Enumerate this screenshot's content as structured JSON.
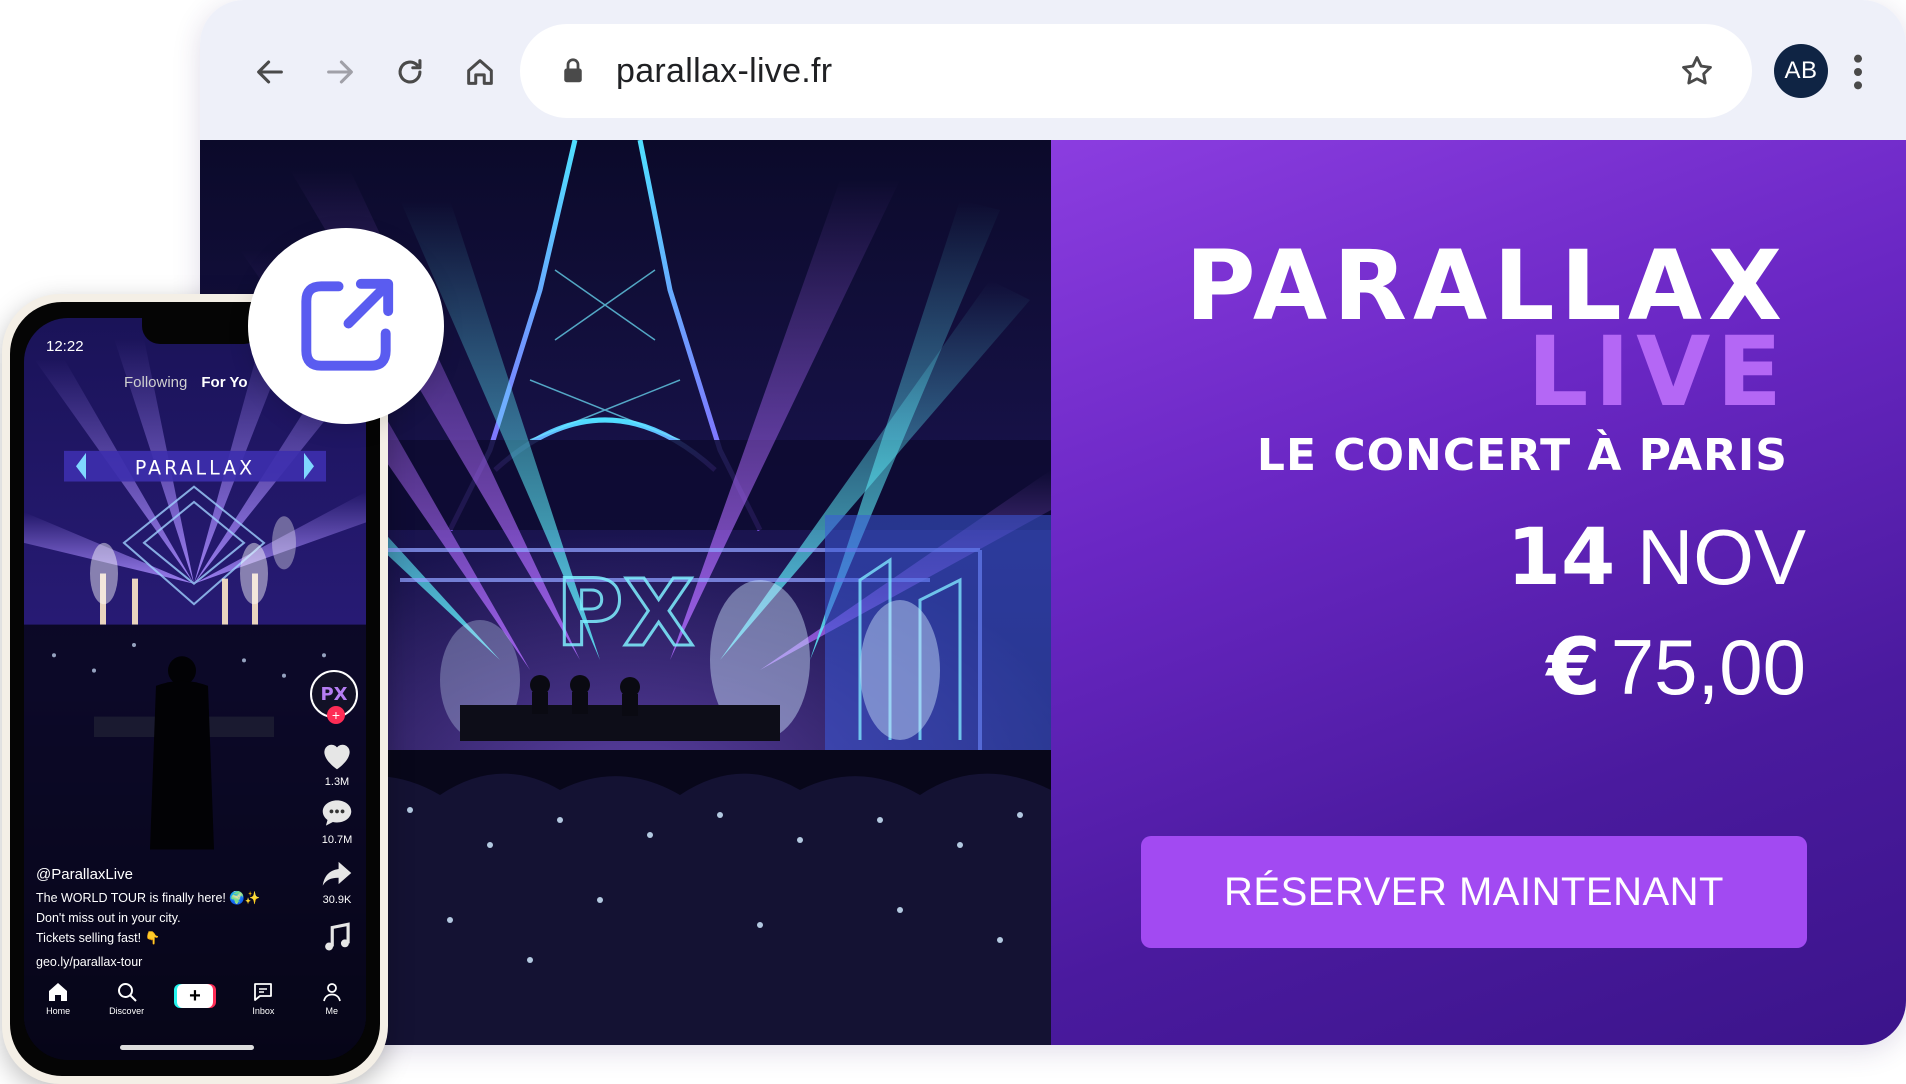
{
  "browser": {
    "url": "parallax-live.fr",
    "avatar_initials": "AB",
    "icons": {
      "back": "arrow-left-icon",
      "forward": "arrow-right-icon",
      "reload": "reload-icon",
      "home": "home-icon",
      "lock": "lock-icon",
      "bookmark": "star-icon",
      "menu": "kebab-menu-icon"
    }
  },
  "event": {
    "brand_line1": "PARALLAX",
    "brand_line2": "LIVE",
    "tagline": "LE CONCERT À PARIS",
    "date_day": "14",
    "date_month": "NOV",
    "price_currency": "€",
    "price_amount": "75,00",
    "cta_label": "RÉSERVER MAINTENANT",
    "hero_logo_text": "PX"
  },
  "phone": {
    "status_time": "12:22",
    "tabs": {
      "following": "Following",
      "for_you": "For Yo"
    },
    "banner_text": "PARALLAX",
    "profile_avatar_text": "PX",
    "likes": "1.3M",
    "comments": "10.7M",
    "shares": "30.9K",
    "handle": "@ParallaxLive",
    "caption_lines": [
      "The WORLD TOUR is finally here! 🌍✨",
      "Don't miss out in your city.",
      "Tickets selling fast! 👇",
      "geo.ly/parallax-tour"
    ],
    "bottom_nav": {
      "home": "Home",
      "discover": "Discover",
      "inbox": "Inbox",
      "me": "Me"
    }
  },
  "share_badge": {
    "icon": "share-external-icon"
  },
  "colors": {
    "accent_purple": "#a24af2",
    "panel_purple": "#6a27c4",
    "brand_live": "#b467f5",
    "toolbar_bg": "#eef0f9",
    "share_icon": "#5a5cf0",
    "avatar_bg": "#0f2444"
  }
}
